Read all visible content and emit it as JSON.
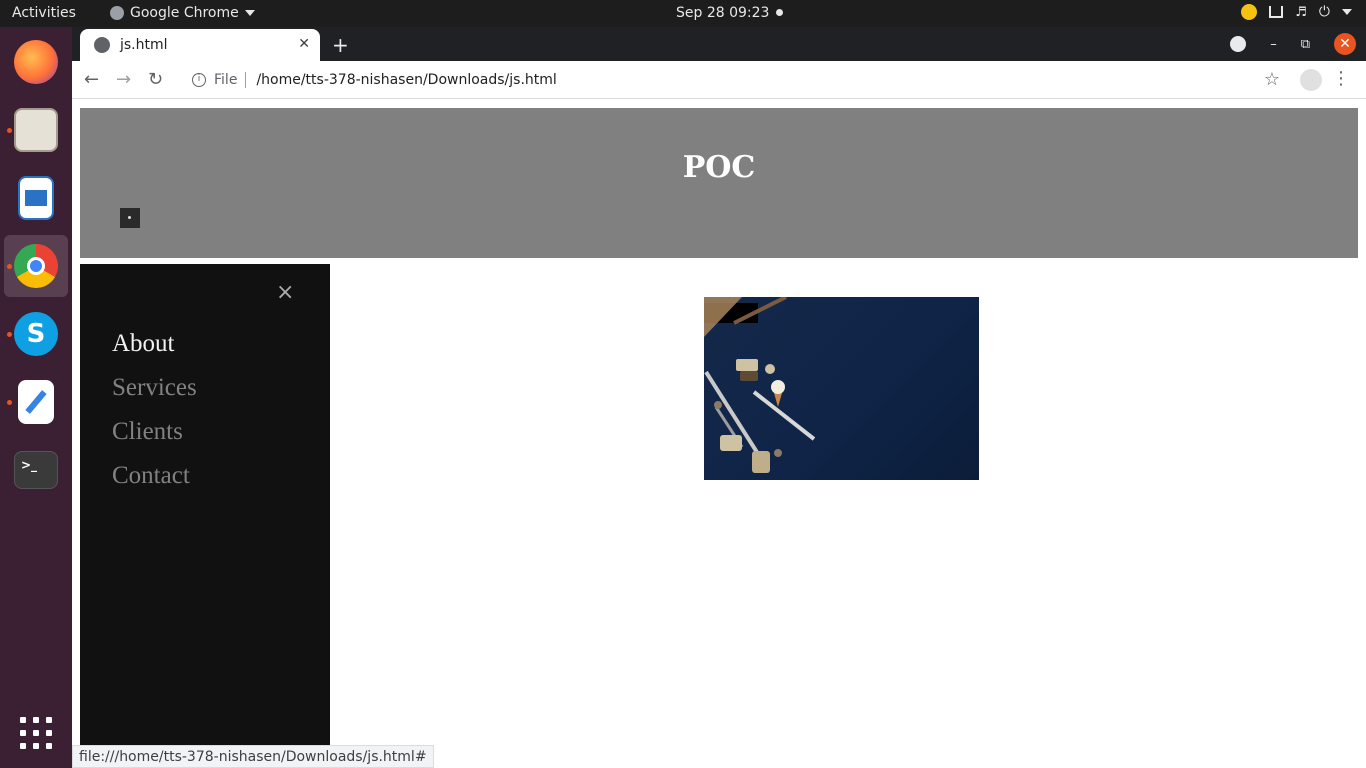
{
  "topbar": {
    "activities": "Activities",
    "app_name": "Google Chrome",
    "clock": "Sep 28  09:23"
  },
  "dock": {
    "apps": [
      "firefox-icon",
      "files-icon",
      "libreoffice-writer-icon",
      "chrome-icon",
      "skype-icon",
      "text-editor-icon",
      "terminal-icon"
    ]
  },
  "browser": {
    "tab_title": "js.html",
    "scheme_label": "File",
    "url": "/home/tts-378-nishasen/Downloads/js.html",
    "status_url": "file:///home/tts-378-nishasen/Downloads/js.html#"
  },
  "page": {
    "header_title": "POC",
    "nav": {
      "close_symbol": "×",
      "items": [
        {
          "label": "About"
        },
        {
          "label": "Services"
        },
        {
          "label": "Clients"
        },
        {
          "label": "Contact"
        }
      ]
    }
  },
  "colors": {
    "header_bg": "#808080",
    "sidenav_bg": "#111111",
    "dock_bg": "#3b1f33",
    "topbar_bg": "#1d1d1d",
    "accent": "#e95420"
  }
}
